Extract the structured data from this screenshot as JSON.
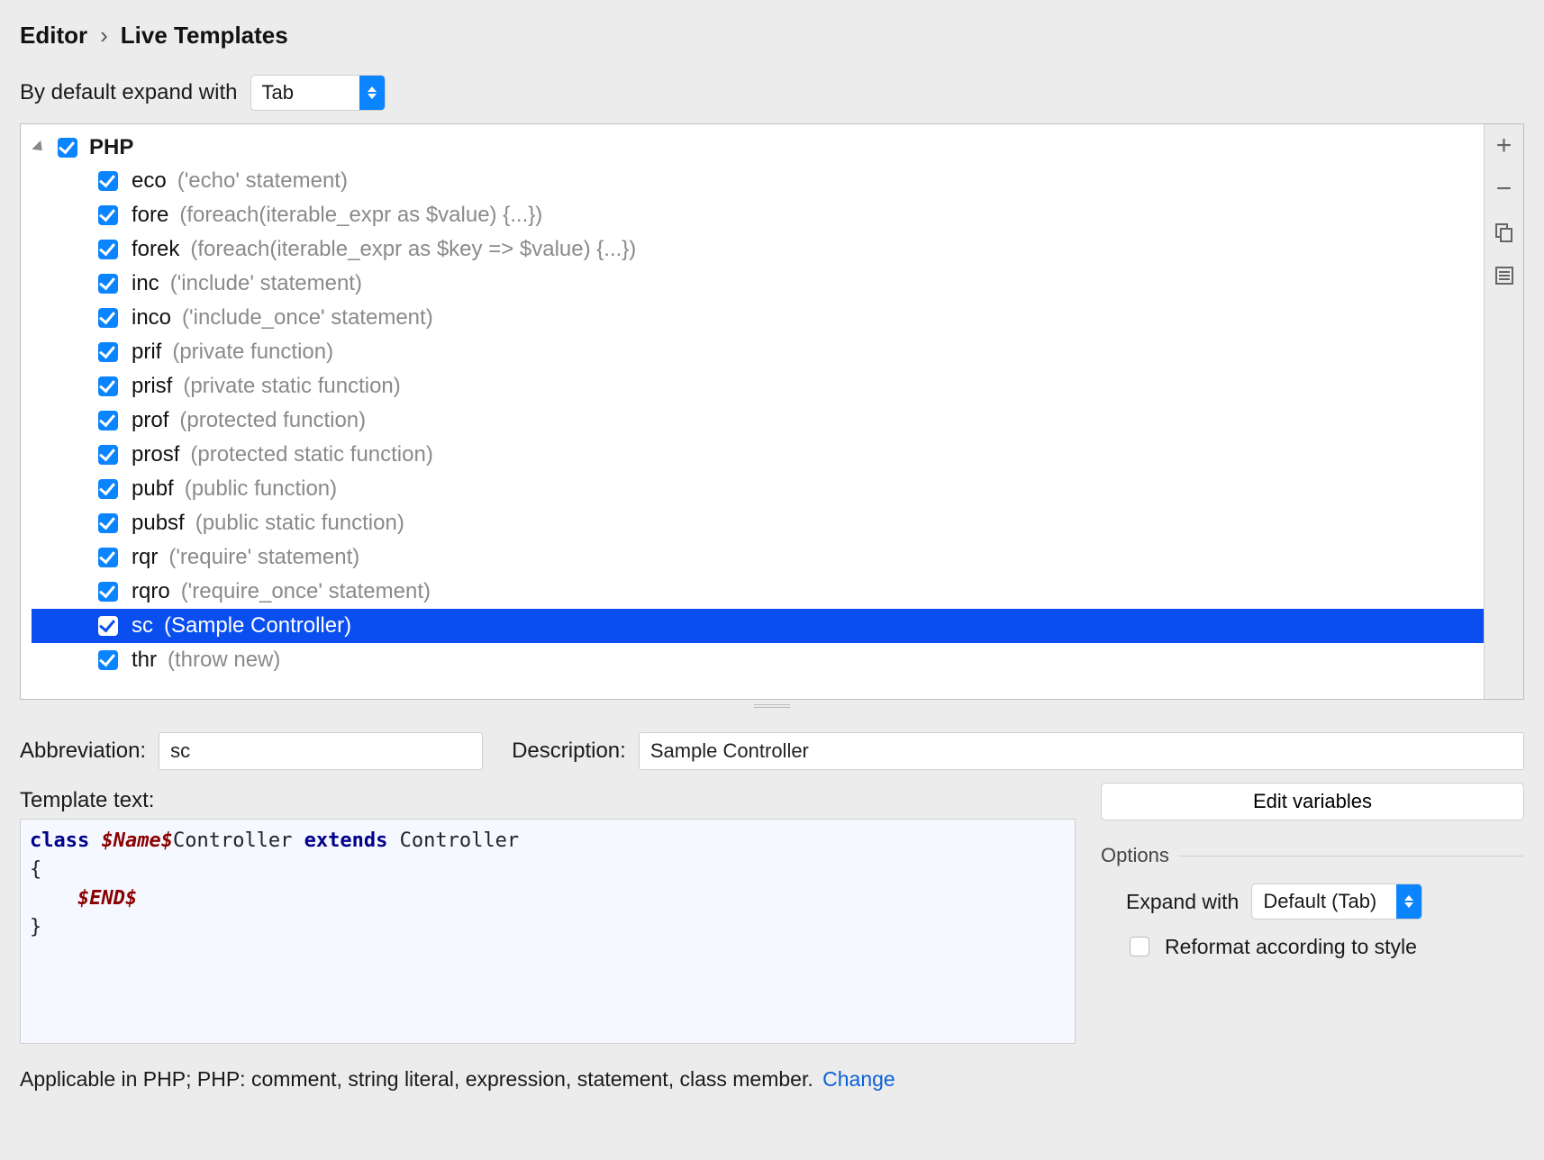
{
  "breadcrumb": {
    "a": "Editor",
    "b": "Live Templates"
  },
  "expand_label": "By default expand with",
  "expand_value": "Tab",
  "toolbar": {
    "add": "+",
    "remove": "−",
    "duplicate": "⧉",
    "list": "≣"
  },
  "group": {
    "name": "PHP",
    "checked": true,
    "items": [
      {
        "abbr": "eco",
        "desc": "('echo' statement)",
        "checked": true,
        "selected": false
      },
      {
        "abbr": "fore",
        "desc": "(foreach(iterable_expr as $value) {...})",
        "checked": true,
        "selected": false
      },
      {
        "abbr": "forek",
        "desc": "(foreach(iterable_expr as $key => $value) {...})",
        "checked": true,
        "selected": false
      },
      {
        "abbr": "inc",
        "desc": "('include' statement)",
        "checked": true,
        "selected": false
      },
      {
        "abbr": "inco",
        "desc": "('include_once' statement)",
        "checked": true,
        "selected": false
      },
      {
        "abbr": "prif",
        "desc": "(private function)",
        "checked": true,
        "selected": false
      },
      {
        "abbr": "prisf",
        "desc": "(private static function)",
        "checked": true,
        "selected": false
      },
      {
        "abbr": "prof",
        "desc": "(protected function)",
        "checked": true,
        "selected": false
      },
      {
        "abbr": "prosf",
        "desc": "(protected static function)",
        "checked": true,
        "selected": false
      },
      {
        "abbr": "pubf",
        "desc": "(public function)",
        "checked": true,
        "selected": false
      },
      {
        "abbr": "pubsf",
        "desc": "(public static function)",
        "checked": true,
        "selected": false
      },
      {
        "abbr": "rqr",
        "desc": "('require' statement)",
        "checked": true,
        "selected": false
      },
      {
        "abbr": "rqro",
        "desc": "('require_once' statement)",
        "checked": true,
        "selected": false
      },
      {
        "abbr": "sc",
        "desc": "(Sample Controller)",
        "checked": true,
        "selected": true
      },
      {
        "abbr": "thr",
        "desc": "(throw new)",
        "checked": true,
        "selected": false
      }
    ]
  },
  "form": {
    "abbr_label": "Abbreviation:",
    "abbr_value": "sc",
    "desc_label": "Description:",
    "desc_value": "Sample Controller",
    "tmpl_label": "Template text:"
  },
  "template_tokens": [
    {
      "t": "kw",
      "s": "class "
    },
    {
      "t": "var",
      "s": "$Name$"
    },
    {
      "t": "",
      "s": "Controller "
    },
    {
      "t": "kw",
      "s": "extends "
    },
    {
      "t": "",
      "s": "Controller\n{\n    "
    },
    {
      "t": "var",
      "s": "$END$"
    },
    {
      "t": "",
      "s": "\n}"
    }
  ],
  "right": {
    "edit_vars": "Edit variables",
    "options": "Options",
    "expand_with_label": "Expand with",
    "expand_with_value": "Default (Tab)",
    "reformat": "Reformat according to style",
    "reformat_checked": false
  },
  "footer": {
    "text": "Applicable in PHP; PHP: comment, string literal, expression, statement, class member.",
    "link": "Change"
  }
}
